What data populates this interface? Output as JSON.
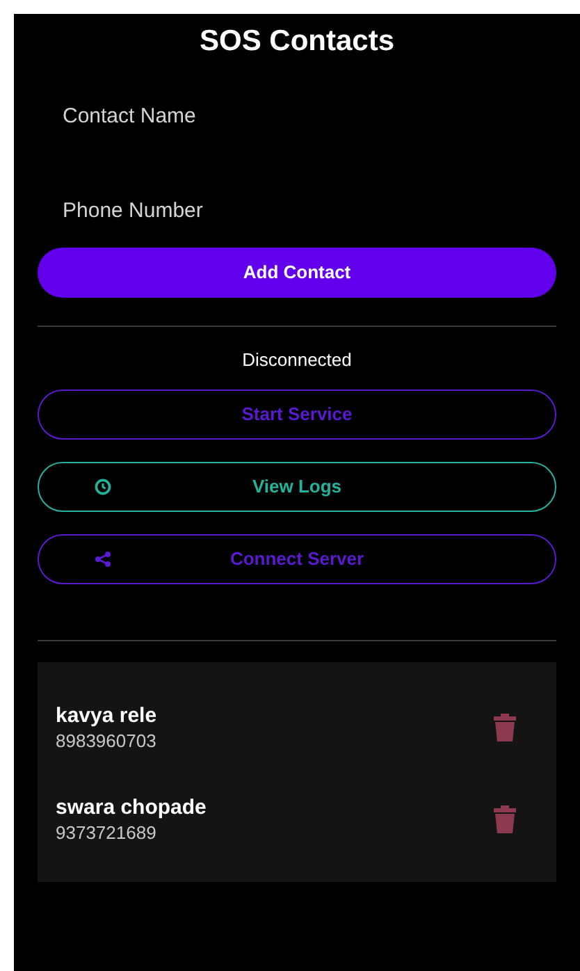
{
  "title": "SOS Contacts",
  "fields": [
    {
      "placeholder": "Contact Name"
    },
    {
      "placeholder": "Phone Number"
    }
  ],
  "add_button": "Add Contact",
  "status": "Disconnected",
  "actions": [
    {
      "label": "Start Service",
      "kind": "plain",
      "color": "#5a1ad0"
    },
    {
      "label": "View Logs",
      "kind": "clock",
      "color": "#22b39c"
    },
    {
      "label": "Connect Server",
      "kind": "share",
      "color": "#5a1ad0"
    }
  ],
  "contacts": [
    {
      "name": "kavya rele",
      "phone": "8983960703"
    },
    {
      "name": "swara chopade",
      "phone": "9373721689"
    }
  ]
}
